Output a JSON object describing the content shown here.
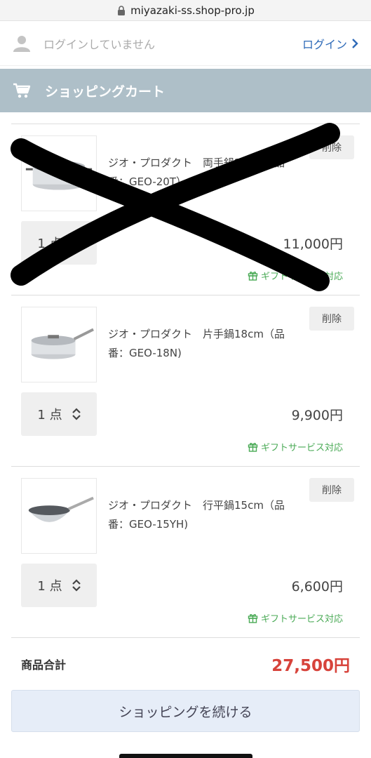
{
  "browser": {
    "url": "miyazaki-ss.shop-pro.jp"
  },
  "account": {
    "status": "ログインしていません",
    "login_label": "ログイン"
  },
  "cart": {
    "title": "ショッピングカート"
  },
  "items": [
    {
      "name": "ジオ・プロダクト　両手鍋20cm（品番：GEO-20T）",
      "delete_label": "削除",
      "quantity": "1 点",
      "price": "11,000円",
      "gift": "ギフトサービス対応"
    },
    {
      "name": "ジオ・プロダクト　片手鍋18cm（品番：GEO-18N)",
      "delete_label": "削除",
      "quantity": "1 点",
      "price": "9,900円",
      "gift": "ギフトサービス対応"
    },
    {
      "name": "ジオ・プロダクト　行平鍋15cm（品番：GEO-15YH)",
      "delete_label": "削除",
      "quantity": "1 点",
      "price": "6,600円",
      "gift": "ギフトサービス対応"
    }
  ],
  "summary": {
    "label": "商品合計",
    "total": "27,500円"
  },
  "actions": {
    "continue_label": "ショッピングを続ける"
  }
}
